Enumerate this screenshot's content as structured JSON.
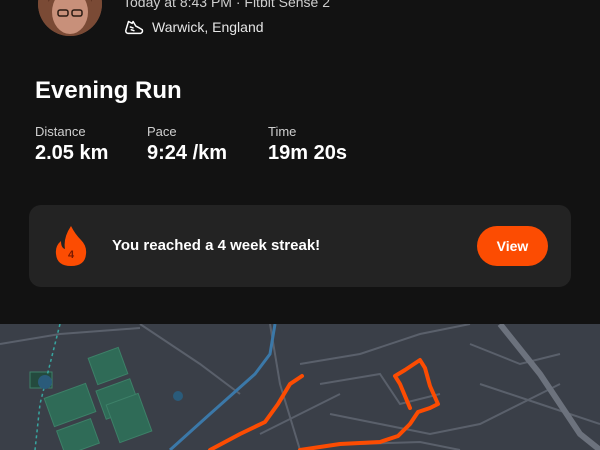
{
  "header": {
    "meta": "Today at 8:43 PM · Fitbit Sense 2",
    "location": "Warwick, England"
  },
  "activity": {
    "title": "Evening Run",
    "stats": [
      {
        "label": "Distance",
        "value": "2.05 km"
      },
      {
        "label": "Pace",
        "value": "9:24 /km"
      },
      {
        "label": "Time",
        "value": "19m 20s"
      }
    ]
  },
  "streak": {
    "weeks": "4",
    "message": "You reached a 4 week streak!",
    "button_label": "View"
  },
  "colors": {
    "accent": "#fc4c02",
    "background": "#121212",
    "card": "#232323",
    "map_base": "#3a3f48",
    "map_park": "#2f6b57"
  },
  "icons": {
    "activity_type": "shoe-icon",
    "streak": "flame-icon"
  }
}
